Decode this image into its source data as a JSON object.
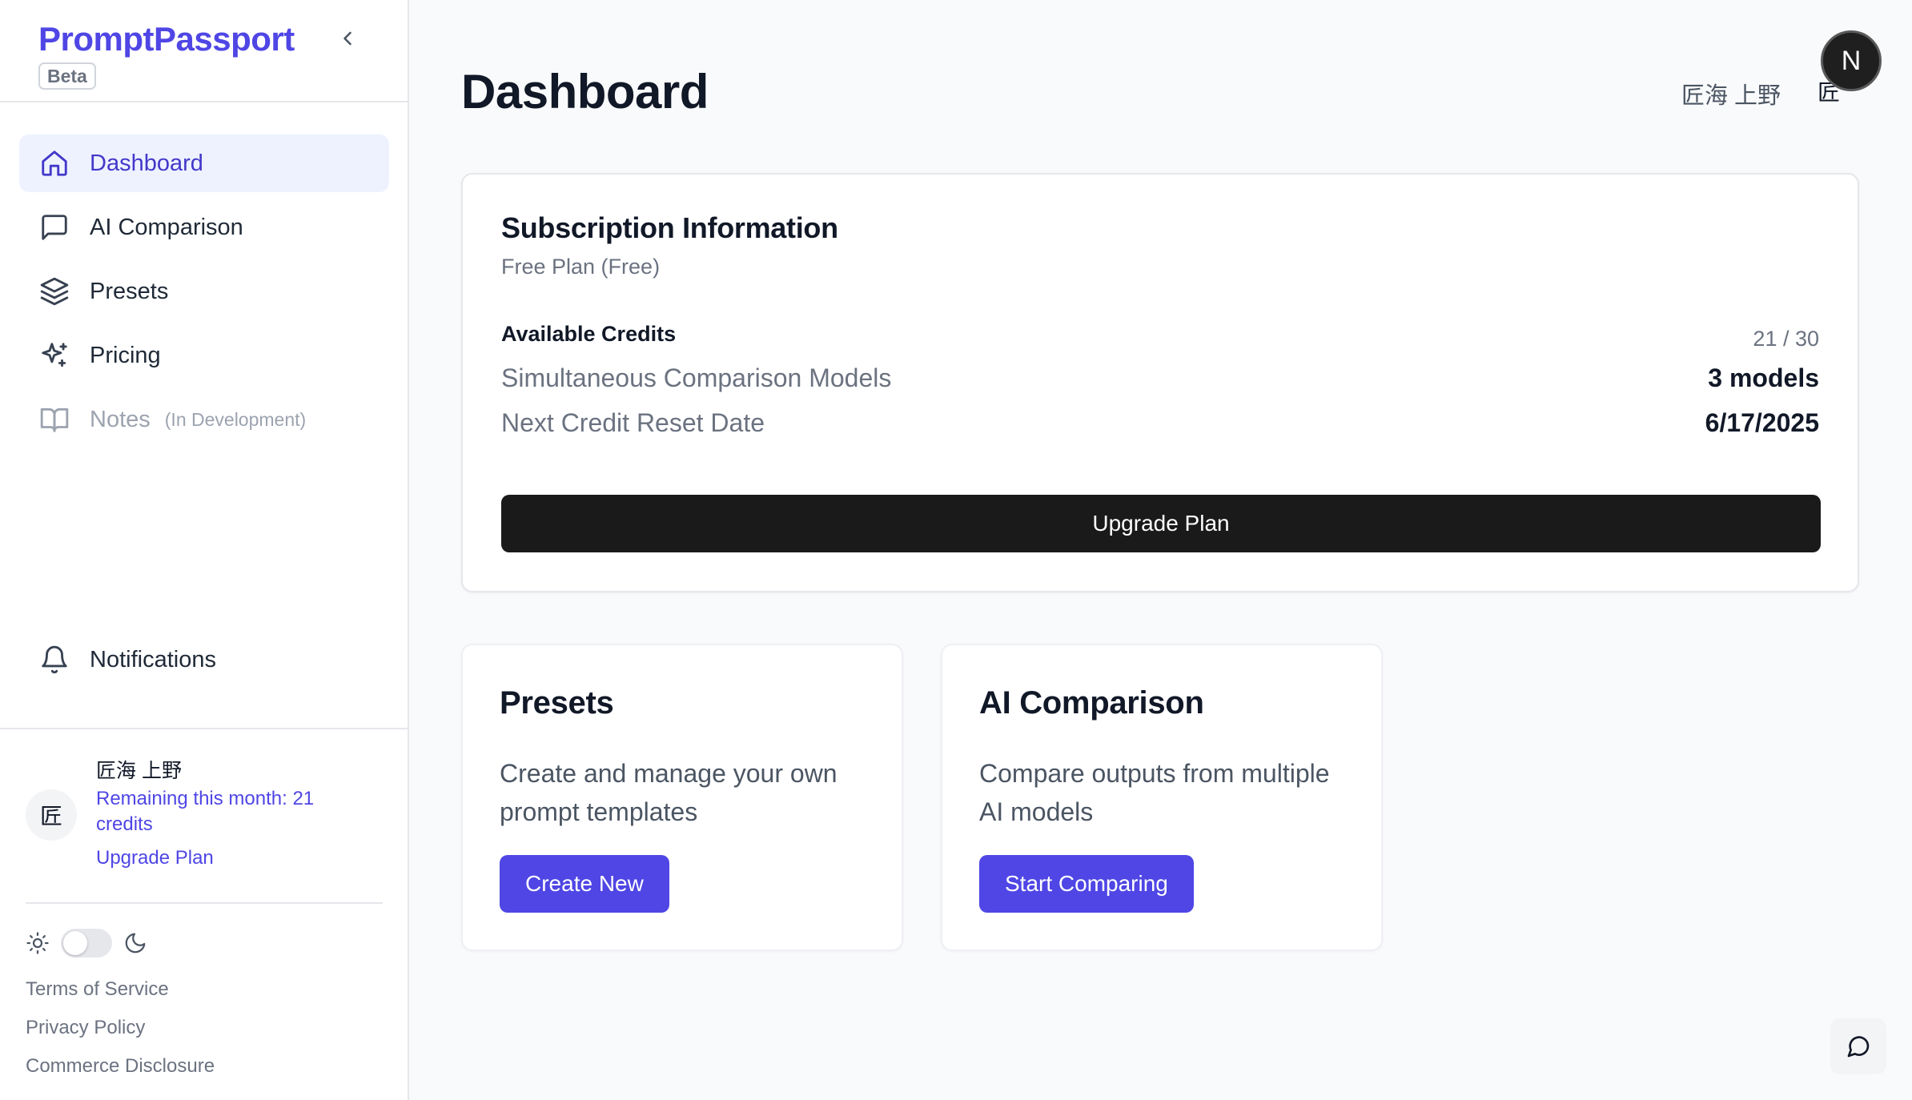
{
  "brand": {
    "name": "PromptPassport",
    "badge": "Beta"
  },
  "nav": {
    "items": [
      {
        "label": "Dashboard",
        "icon": "home-icon",
        "active": true
      },
      {
        "label": "AI Comparison",
        "icon": "message-square-icon"
      },
      {
        "label": "Presets",
        "icon": "layers-icon"
      },
      {
        "label": "Pricing",
        "icon": "sparkles-icon"
      },
      {
        "label": "Notes",
        "icon": "book-open-icon",
        "note": "(In Development)"
      }
    ],
    "notifications": {
      "label": "Notifications",
      "icon": "bell-icon"
    }
  },
  "user": {
    "name": "匠海 上野",
    "initial": "匠",
    "remaining": "Remaining this month: 21 credits",
    "upgrade": "Upgrade Plan"
  },
  "footer": {
    "links": [
      "Terms of Service",
      "Privacy Policy",
      "Commerce Disclosure"
    ]
  },
  "header": {
    "title": "Dashboard",
    "user_name": "匠海 上野",
    "user_initial": "匠",
    "badge_letter": "N"
  },
  "subscription": {
    "title": "Subscription Information",
    "plan": "Free Plan (Free)",
    "credits_label": "Available Credits",
    "credits_value": "21 / 30",
    "models_label": "Simultaneous Comparison Models",
    "models_value": "3 models",
    "reset_label": "Next Credit Reset Date",
    "reset_value": "6/17/2025",
    "button": "Upgrade Plan"
  },
  "cards": [
    {
      "title": "Presets",
      "desc": "Create and manage your own prompt templates",
      "button": "Create New"
    },
    {
      "title": "AI Comparison",
      "desc": "Compare outputs from multiple AI models",
      "button": "Start Comparing"
    }
  ],
  "colors": {
    "accent": "#4f46e5",
    "active_bg": "#eef2ff",
    "dark_button": "#1a1a1a"
  }
}
